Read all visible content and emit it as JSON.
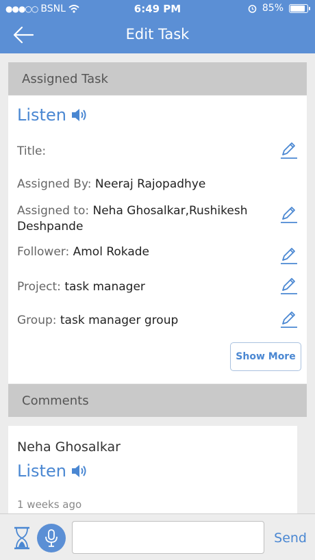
{
  "status_bar": {
    "carrier": "BSNL",
    "time": "6:49 PM",
    "battery": "85%"
  },
  "nav": {
    "title": "Edit Task",
    "back_icon": "arrow-left-icon"
  },
  "assigned_task": {
    "header": "Assigned Task",
    "listen_label": "Listen",
    "title_label": "Title:",
    "title_value": "",
    "assigned_by_label": "Assigned By:",
    "assigned_by_value": "Neeraj Rajopadhye",
    "assigned_to_label": "Assigned to:",
    "assigned_to_value": "Neha Ghosalkar,Rushikesh Deshpande",
    "follower_label": "Follower:",
    "follower_value": "Amol Rokade",
    "project_label": "Project:",
    "project_value": "task manager",
    "group_label": "Group:",
    "group_value": "task manager group",
    "show_more_label": "Show More"
  },
  "comments": {
    "header": "Comments",
    "items": [
      {
        "author": "Neha Ghosalkar",
        "listen_label": "Listen",
        "time": "1 weeks ago"
      }
    ]
  },
  "composer": {
    "input_value": "",
    "input_placeholder": "",
    "send_label": "Send"
  },
  "colors": {
    "primary": "#5b8fd5",
    "accent": "#4a87d2"
  }
}
